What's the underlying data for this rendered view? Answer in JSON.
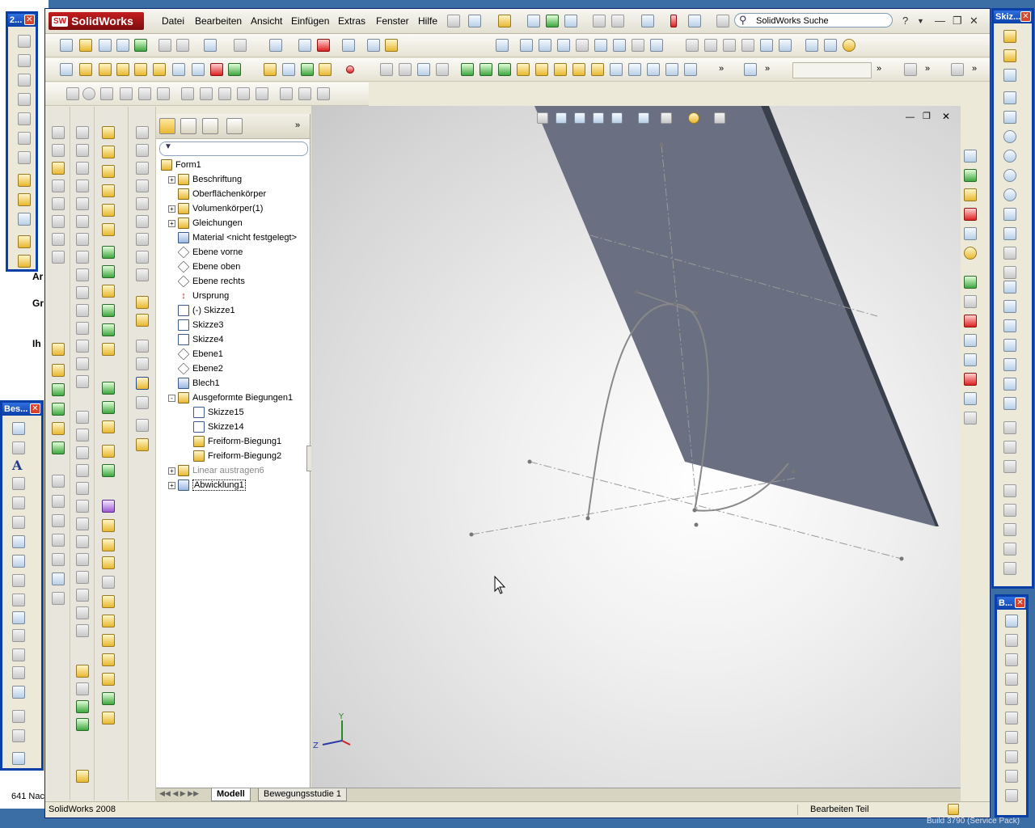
{
  "app": {
    "logo_text": "SolidWorks",
    "logo_badge": "SW",
    "menu": [
      "Datei",
      "Bearbeiten",
      "Ansicht",
      "Einfügen",
      "Extras",
      "Fenster",
      "Hilfe"
    ],
    "search_placeholder": "SolidWorks Suche",
    "help_label": "?"
  },
  "tree": {
    "items": [
      {
        "label": "Form1",
        "icon": "part-icon",
        "expand": "none",
        "indent": 0
      },
      {
        "label": "Beschriftung",
        "icon": "annotation-icon",
        "expand": "+",
        "indent": 1
      },
      {
        "label": "Oberflächenkörper",
        "icon": "surface-bodies-icon",
        "expand": "none",
        "indent": 1
      },
      {
        "label": "Volumenkörper(1)",
        "icon": "solid-bodies-icon",
        "expand": "+",
        "indent": 1
      },
      {
        "label": "Gleichungen",
        "icon": "equations-icon",
        "expand": "+",
        "indent": 1
      },
      {
        "label": "Material <nicht festgelegt>",
        "icon": "material-icon",
        "expand": "none",
        "indent": 1
      },
      {
        "label": "Ebene vorne",
        "icon": "plane-icon",
        "expand": "none",
        "indent": 1
      },
      {
        "label": "Ebene oben",
        "icon": "plane-icon",
        "expand": "none",
        "indent": 1
      },
      {
        "label": "Ebene rechts",
        "icon": "plane-icon",
        "expand": "none",
        "indent": 1
      },
      {
        "label": "Ursprung",
        "icon": "origin-icon",
        "expand": "none",
        "indent": 1
      },
      {
        "label": "(-) Skizze1",
        "icon": "sketch-icon",
        "expand": "none",
        "indent": 1
      },
      {
        "label": "Skizze3",
        "icon": "sketch-icon",
        "expand": "none",
        "indent": 1
      },
      {
        "label": "Skizze4",
        "icon": "sketch-icon",
        "expand": "none",
        "indent": 1
      },
      {
        "label": "Ebene1",
        "icon": "plane-icon",
        "expand": "none",
        "indent": 1
      },
      {
        "label": "Ebene2",
        "icon": "plane-icon",
        "expand": "none",
        "indent": 1
      },
      {
        "label": "Blech1",
        "icon": "sheetmetal-icon",
        "expand": "none",
        "indent": 1
      },
      {
        "label": "Ausgeformte Biegungen1",
        "icon": "lofted-bend-icon",
        "expand": "-",
        "indent": 1
      },
      {
        "label": "Skizze15",
        "icon": "sketch-icon",
        "expand": "none",
        "indent": 2
      },
      {
        "label": "Skizze14",
        "icon": "sketch-icon",
        "expand": "none",
        "indent": 2
      },
      {
        "label": "Freiform-Biegung1",
        "icon": "bend-icon",
        "expand": "none",
        "indent": 2
      },
      {
        "label": "Freiform-Biegung2",
        "icon": "bend-icon",
        "expand": "none",
        "indent": 2
      },
      {
        "label": "Linear austragen6",
        "icon": "extrude-icon",
        "expand": "+",
        "indent": 1,
        "suppressed": true
      },
      {
        "label": "Abwicklung1",
        "icon": "flatten-icon",
        "expand": "+",
        "indent": 1,
        "selected": true
      }
    ]
  },
  "bottom_tabs": [
    "Modell",
    "Bewegungsstudie 1"
  ],
  "status": {
    "left": "SolidWorks 2008",
    "mode": "Bearbeiten Teil",
    "build": "Build 3790 (Service Pack)"
  },
  "floating": {
    "left_top_title": "2...",
    "left_mid_title": "Bes...",
    "right_top_title": "Skiz...",
    "right_bottom_title": "B..."
  },
  "triad": {
    "y": "Y",
    "z": "Z"
  },
  "background_fragments": [
    "Ar",
    "Gr",
    "Ih",
    "641 Nac"
  ],
  "colors": {
    "accent_titlebar": "#0a3fa8",
    "sheet_metal": "#6a7082",
    "sketch_lines": "#808080"
  }
}
